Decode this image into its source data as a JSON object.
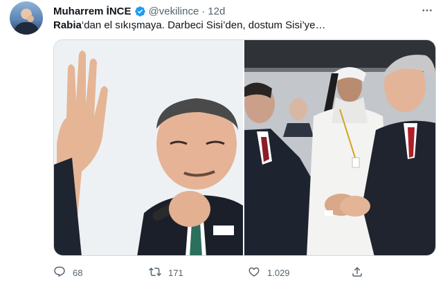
{
  "tweet": {
    "author_name": "Muharrem İNCE",
    "handle": "@vekilince",
    "separator": "·",
    "time": "12d",
    "text_bold": "Rabia",
    "text_rest": "‘dan el sıkışmaya. Darbeci Sisi’den, dostum Sisi’ye…",
    "verified_icon": "verified-badge-icon",
    "colors": {
      "verified": "#1d9bf0",
      "secondary": "#536471",
      "primary": "#0f1419"
    }
  },
  "media": {
    "images": [
      {
        "icon": "photo-speaker-with-microphone"
      },
      {
        "icon": "photo-handshake-group"
      }
    ]
  },
  "actions": {
    "reply_count": "68",
    "retweet_count": "171",
    "like_count": "1.029"
  }
}
